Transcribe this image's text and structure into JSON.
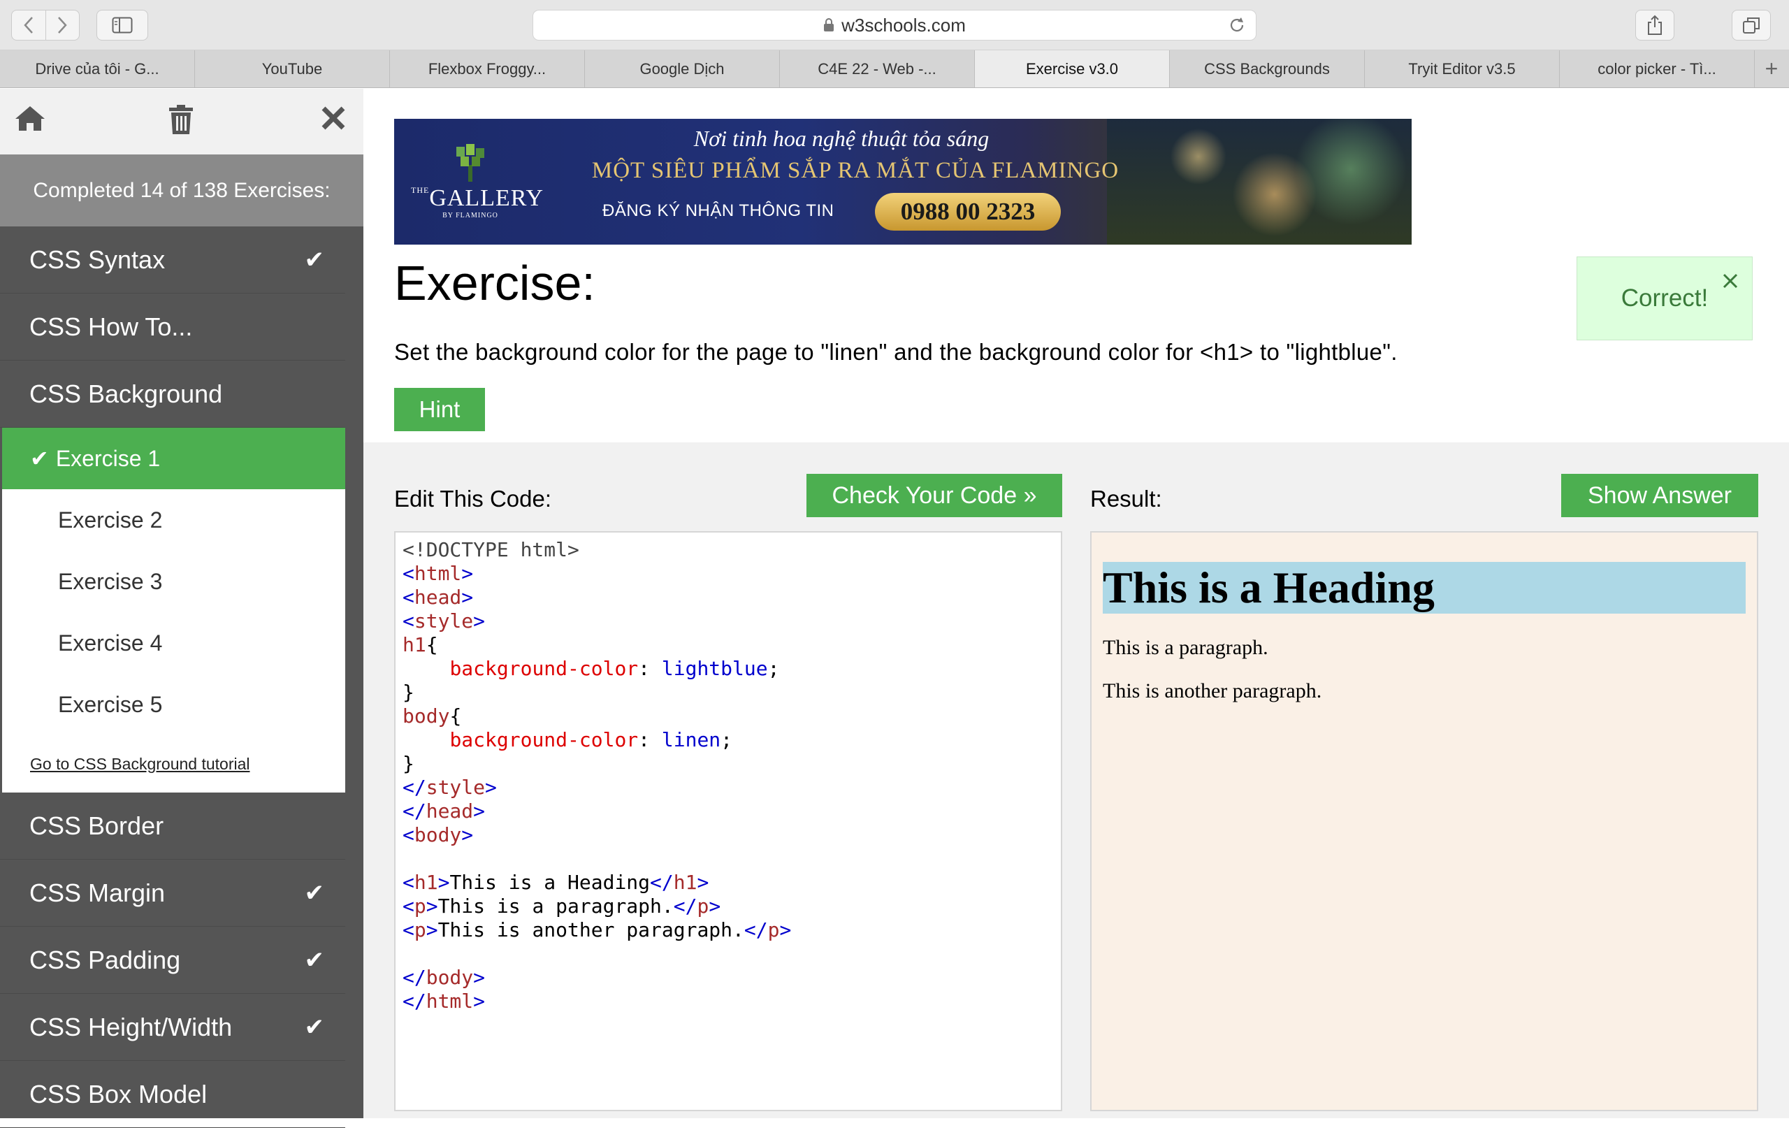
{
  "browser": {
    "url": "w3schools.com",
    "tabs": [
      {
        "label": "Drive của tôi - G..."
      },
      {
        "label": "YouTube"
      },
      {
        "label": "Flexbox Froggy..."
      },
      {
        "label": "Google Dịch"
      },
      {
        "label": "C4E 22 - Web -..."
      },
      {
        "label": "Exercise v3.0",
        "active": true
      },
      {
        "label": "CSS Backgrounds"
      },
      {
        "label": "Tryit Editor v3.5"
      },
      {
        "label": "color picker - Tì..."
      }
    ],
    "new_tab_glyph": "+"
  },
  "sidebar": {
    "progress": "Completed 14 of 138 Exercises:",
    "completed": 14,
    "total": 138,
    "check_glyph": "✔",
    "sections_before": [
      {
        "label": "CSS Syntax",
        "done": true
      },
      {
        "label": "CSS How To...",
        "done": false
      },
      {
        "label": "CSS Background",
        "done": false
      }
    ],
    "sub_items": [
      {
        "label": "Exercise 1",
        "active": true
      },
      {
        "label": "Exercise 2",
        "active": false
      },
      {
        "label": "Exercise 3",
        "active": false
      },
      {
        "label": "Exercise 4",
        "active": false
      },
      {
        "label": "Exercise 5",
        "active": false
      }
    ],
    "tutorial_link": "Go to CSS Background tutorial",
    "sections_after": [
      {
        "label": "CSS Border",
        "done": false
      },
      {
        "label": "CSS Margin",
        "done": true
      },
      {
        "label": "CSS Padding",
        "done": true
      },
      {
        "label": "CSS Height/Width",
        "done": true
      },
      {
        "label": "CSS Box Model",
        "done": false
      }
    ]
  },
  "banner": {
    "logo_brand": "GALLERY",
    "logo_prefix": "THE",
    "logo_sub": "BY FLAMINGO",
    "tagline": "Nơi tinh hoa nghệ thuật tỏa sáng",
    "headline": "MỘT SIÊU PHẨM SẮP RA MẮT CỦA FLAMINGO",
    "register": "ĐĂNG KÝ NHẬN THÔNG TIN",
    "phone": "0988 00 2323"
  },
  "exercise": {
    "title": "Exercise:",
    "description": "Set the background color for the page to \"linen\" and the background color for <h1> to \"lightblue\".",
    "hint_label": "Hint",
    "correct_label": "Correct!",
    "close_glyph": "✕",
    "edit_label": "Edit This Code:",
    "check_label": "Check Your Code »",
    "result_label": "Result:",
    "answer_label": "Show Answer"
  },
  "result": {
    "heading": "This is a Heading",
    "p1": "This is a paragraph.",
    "p2": "This is another paragraph."
  },
  "colors": {
    "accent_green": "#4caf50",
    "sidebar_dark": "#555555",
    "linen": "#faf0e6",
    "lightblue": "#add8e6",
    "correct_bg": "#ddffdd"
  }
}
